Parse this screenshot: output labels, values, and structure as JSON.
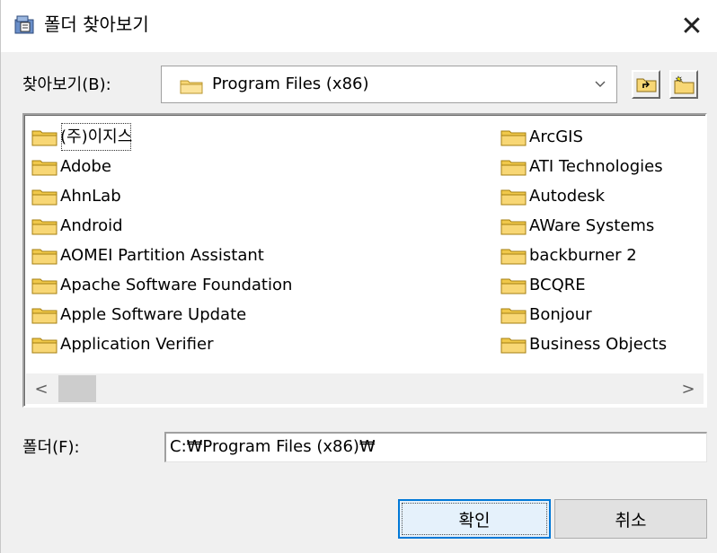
{
  "window": {
    "title": "폴더 찾아보기",
    "close_glyph": "✕",
    "icon": "folder-browse-icon"
  },
  "look_in": {
    "label": "찾아보기(B):",
    "value": "Program Files (x86)",
    "up_button_icon": "up-one-level-icon",
    "new_folder_button_icon": "new-folder-icon"
  },
  "folders": {
    "left_column": [
      "(주)이지스",
      "Adobe",
      "AhnLab",
      "Android",
      "AOMEI Partition Assistant",
      "Apache Software Foundation",
      "Apple Software Update",
      "Application Verifier"
    ],
    "right_column": [
      "ArcGIS",
      "ATI Technologies",
      "Autodesk",
      "AWare Systems",
      "backburner 2",
      "BCQRE",
      "Bonjour",
      "Business Objects"
    ],
    "focused": "(주)이지스"
  },
  "scrollbar": {
    "left_glyph": "<",
    "right_glyph": ">"
  },
  "folder_field": {
    "label": "폴더(F):",
    "value": "C:₩Program Files (x86)₩"
  },
  "buttons": {
    "ok": "확인",
    "cancel": "취소"
  },
  "colors": {
    "folder_yellow": "#f8d775",
    "focus_blue": "#0078d7",
    "dialog_bg": "#f0f0f0"
  }
}
